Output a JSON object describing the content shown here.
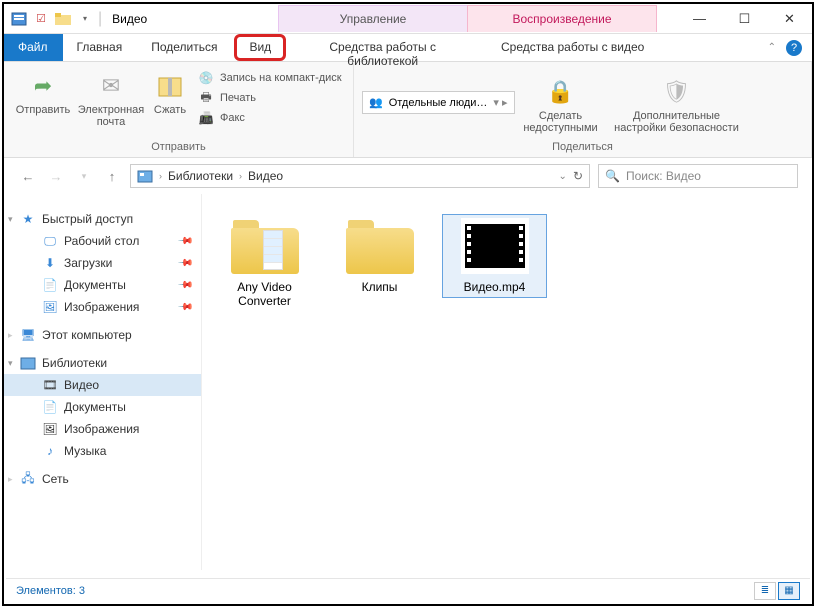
{
  "title": "Видео",
  "context_tabs": {
    "manage": "Управление",
    "playback": "Воспроизведение"
  },
  "ribbon_tabs": {
    "file": "Файл",
    "home": "Главная",
    "share": "Поделиться",
    "view": "Вид",
    "library_tools": "Средства работы с библиотекой",
    "video_tools": "Средства работы с видео"
  },
  "ribbon": {
    "send_group": "Отправить",
    "share_group": "Поделиться",
    "send": "Отправить",
    "email": "Электронная почта",
    "zip": "Сжать",
    "burn": "Запись на компакт-диск",
    "print": "Печать",
    "fax": "Факс",
    "specific_people": "Отдельные люди…",
    "remove_access": "Сделать недоступными",
    "adv_security": "Дополнительные настройки безопасности"
  },
  "breadcrumb": {
    "root": "Библиотеки",
    "current": "Видео"
  },
  "search_placeholder": "Поиск: Видео",
  "sidebar": {
    "quick_access": "Быстрый доступ",
    "desktop": "Рабочий стол",
    "downloads": "Загрузки",
    "documents": "Документы",
    "pictures": "Изображения",
    "this_pc": "Этот компьютер",
    "libraries": "Библиотеки",
    "videos": "Видео",
    "lib_documents": "Документы",
    "lib_pictures": "Изображения",
    "lib_music": "Музыка",
    "network": "Сеть"
  },
  "items": {
    "any_video_converter": "Any Video Converter",
    "clips": "Клипы",
    "video_mp4": "Видео.mp4"
  },
  "status": {
    "count_label": "Элементов: 3"
  }
}
